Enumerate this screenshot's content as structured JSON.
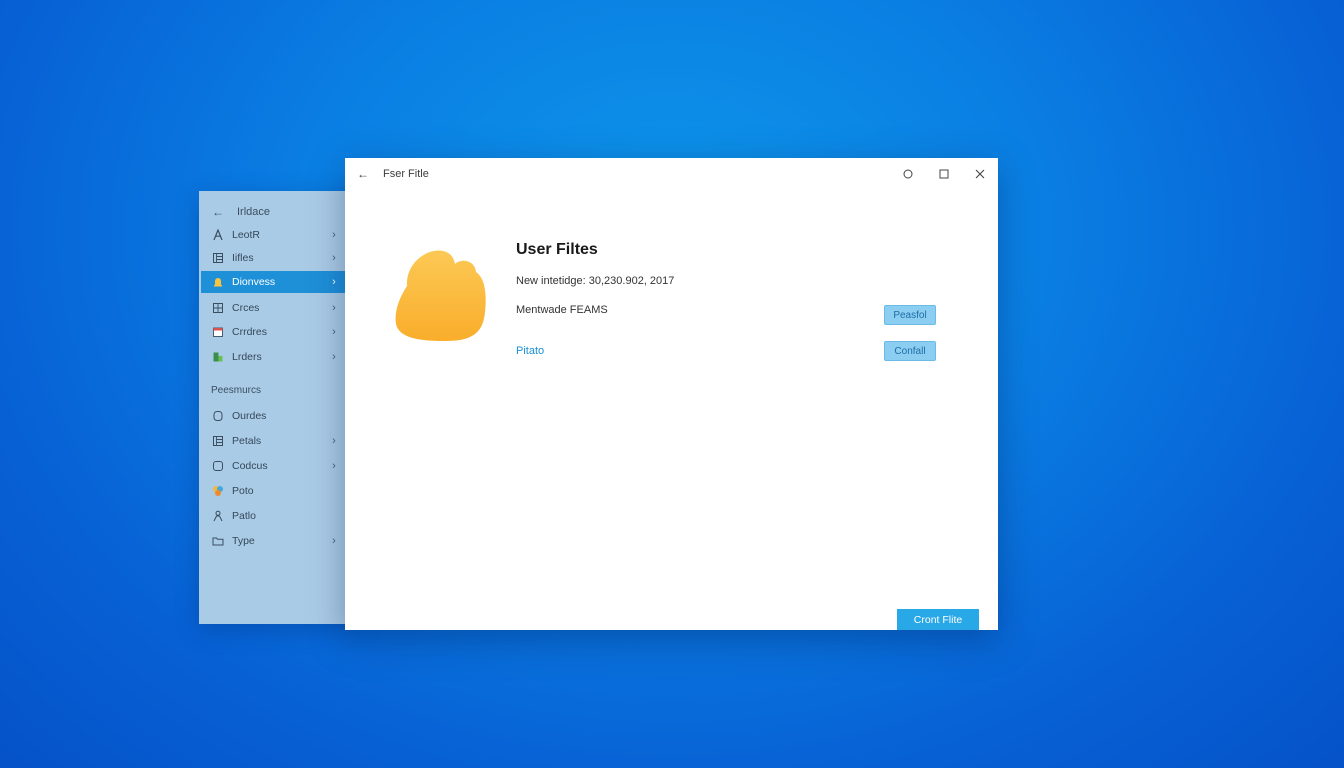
{
  "nav": {
    "back_icon": "arrow-left-icon",
    "title": "Irldace",
    "items": [
      {
        "label": "LeotR",
        "icon": "letter-a-icon",
        "chevron": true
      },
      {
        "label": "Iifles",
        "icon": "list-icon",
        "chevron": true
      },
      {
        "label": "Dionvess",
        "icon": "bell-icon",
        "chevron": true,
        "active": true
      },
      {
        "label": "Crces",
        "icon": "grid-icon",
        "chevron": true
      },
      {
        "label": "Crrdres",
        "icon": "calendar-icon",
        "chevron": true
      },
      {
        "label": "Lrders",
        "icon": "green-block-icon",
        "chevron": true
      }
    ],
    "section_label": "Peesmurcs",
    "section_items": [
      {
        "label": "Ourdes",
        "icon": "circle-outline-icon",
        "chevron": false
      },
      {
        "label": "Petals",
        "icon": "list-icon",
        "chevron": true
      },
      {
        "label": "Codcus",
        "icon": "rounded-square-icon",
        "chevron": true
      },
      {
        "label": "Poto",
        "icon": "colorful-photo-icon",
        "chevron": false
      },
      {
        "label": "Patlo",
        "icon": "person-icon",
        "chevron": false
      },
      {
        "label": "Type",
        "icon": "folder-outline-icon",
        "chevron": true
      }
    ],
    "colors": {
      "active_bg": "#1e90d8",
      "panel_bg": "#aacbe6"
    }
  },
  "window": {
    "back_icon": "arrow-left-icon",
    "title": "Fser Fitle",
    "controls": [
      "minimize-circle-icon",
      "maximize-icon",
      "close-icon"
    ]
  },
  "content": {
    "folder_icon": "folder-cloud-icon",
    "heading": "User Filtes",
    "info_line_1": "New intetidge: 30,230.902, 2017",
    "info_line_2": "Mentwade FEAMS",
    "link_text": "Pitato",
    "button_1": "Peasfol",
    "button_2": "Confall",
    "primary_button": "Cront Flite",
    "colors": {
      "folder": "#fbb93e",
      "accent": "#29a8e8",
      "link": "#1a8fd4"
    }
  }
}
